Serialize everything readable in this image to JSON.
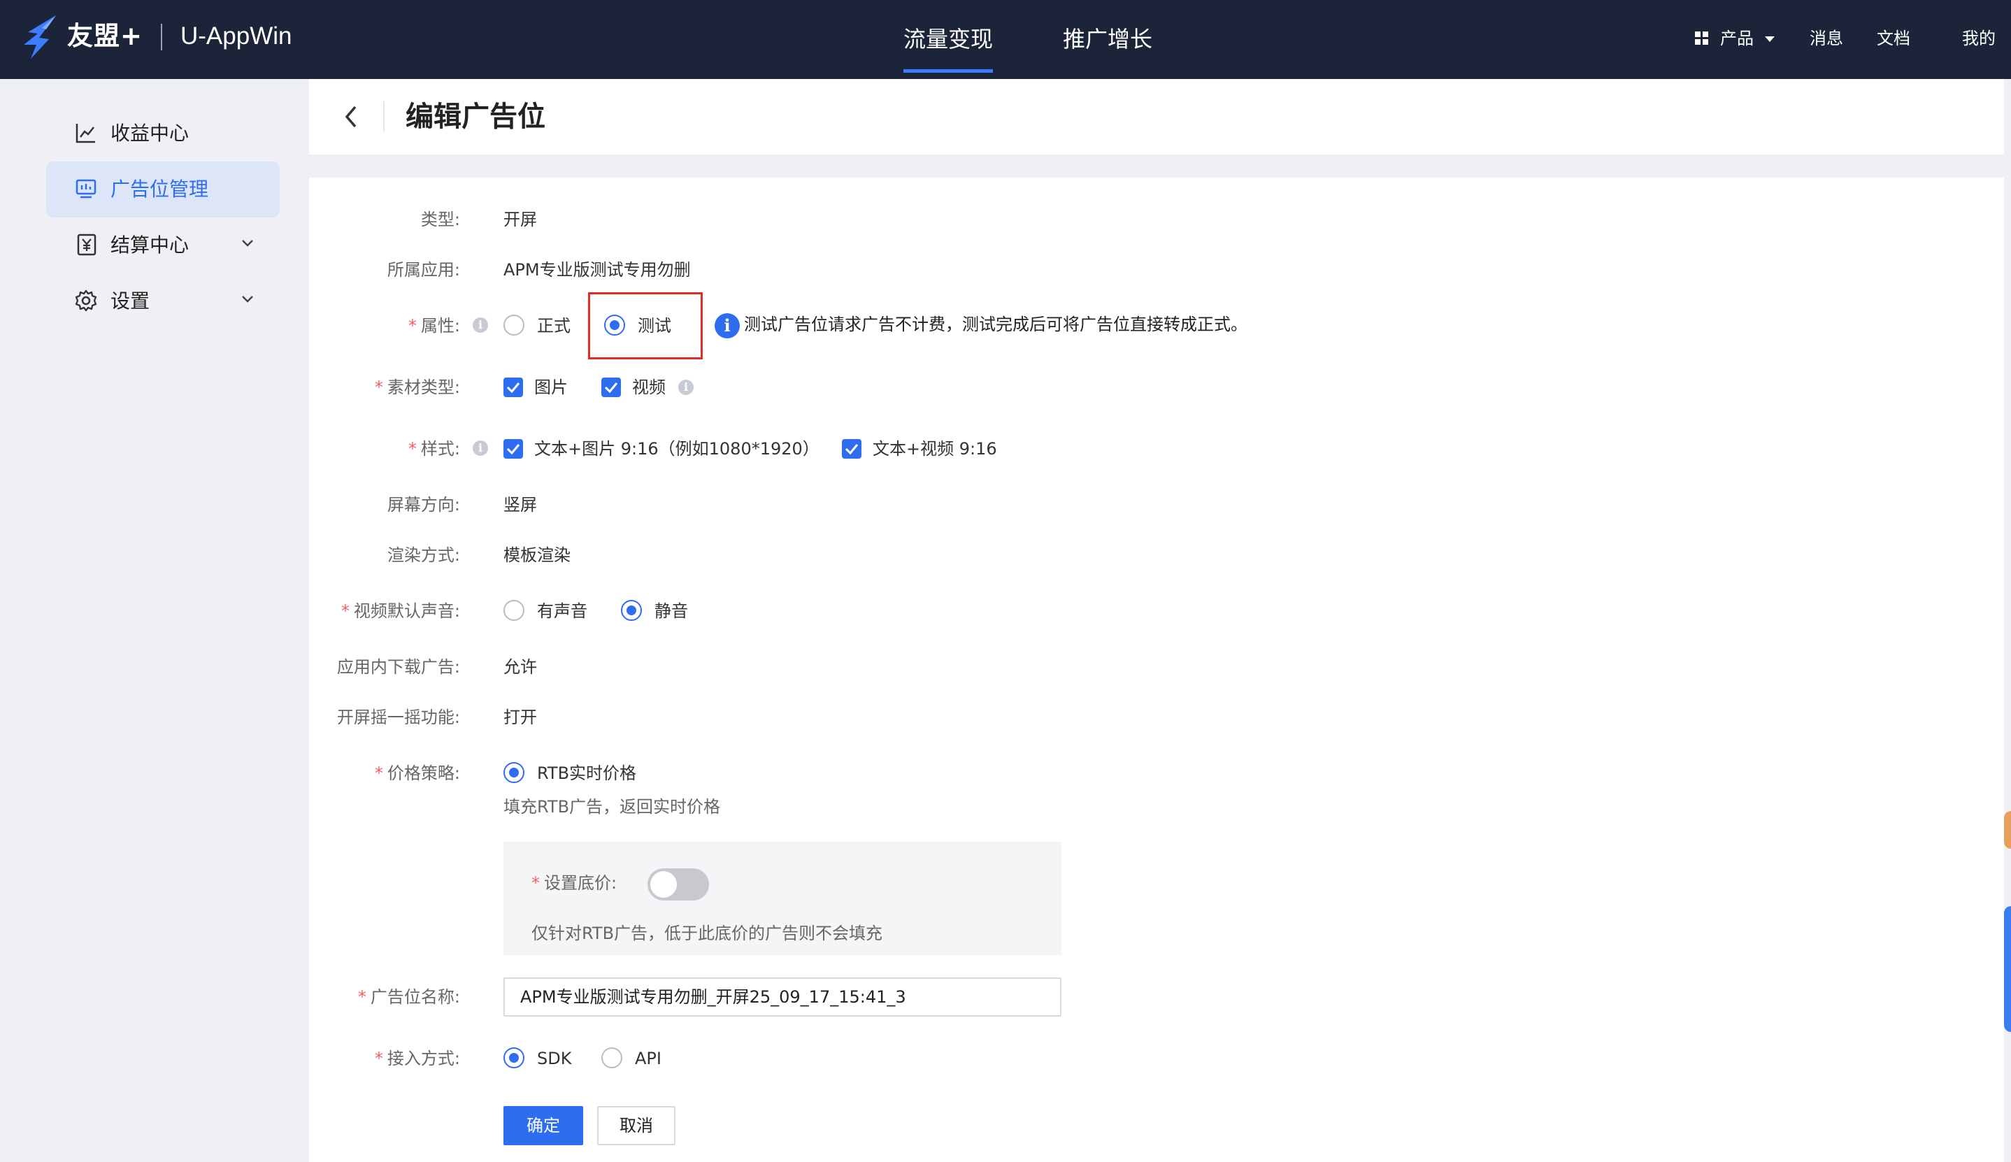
{
  "topbar": {
    "brand": "友盟+",
    "product": "U-AppWin",
    "nav": [
      "流量变现",
      "推广增长"
    ],
    "right": {
      "products": "产品",
      "messages": "消息",
      "docs": "文档",
      "mine": "我的"
    }
  },
  "sidebar": {
    "items": [
      {
        "label": "收益中心",
        "icon": "chart-icon"
      },
      {
        "label": "广告位管理",
        "icon": "monitor-icon",
        "active": true
      },
      {
        "label": "结算中心",
        "icon": "yen-icon"
      },
      {
        "label": "设置",
        "icon": "gear-icon"
      }
    ]
  },
  "header": {
    "title": "编辑广告位"
  },
  "form": {
    "type": {
      "label": "类型:",
      "value": "开屏"
    },
    "app": {
      "label": "所属应用:",
      "value": "APM专业版测试专用勿删"
    },
    "attribute": {
      "label": "属性:",
      "options": [
        "正式",
        "测试"
      ],
      "selected": "测试",
      "hint": "测试广告位请求广告不计费，测试完成后可将广告位直接转成正式。"
    },
    "material": {
      "label": "素材类型:",
      "options": [
        "图片",
        "视频"
      ]
    },
    "style": {
      "label": "样式:",
      "options": [
        "文本+图片 9:16（例如1080*1920）",
        "文本+视频 9:16"
      ]
    },
    "orientation": {
      "label": "屏幕方向:",
      "value": "竖屏"
    },
    "render": {
      "label": "渲染方式:",
      "value": "模板渲染"
    },
    "sound": {
      "label": "视频默认声音:",
      "options": [
        "有声音",
        "静音"
      ],
      "selected": "静音"
    },
    "download": {
      "label": "应用内下载广告:",
      "value": "允许"
    },
    "shake": {
      "label": "开屏摇一摇功能:",
      "value": "打开"
    },
    "price": {
      "label": "价格策略:",
      "option": "RTB实时价格",
      "desc": "填充RTB广告，返回实时价格",
      "floor_label": "设置底价:",
      "floor_enabled": false,
      "floor_desc": "仅针对RTB广告，低于此底价的广告则不会填充"
    },
    "name": {
      "label": "广告位名称:",
      "value": "APM专业版测试专用勿删_开屏25_09_17_15:41_3"
    },
    "access": {
      "label": "接入方式:",
      "options": [
        "SDK",
        "API"
      ],
      "selected": "SDK"
    },
    "buttons": {
      "confirm": "确定",
      "cancel": "取消"
    }
  },
  "colors": {
    "primary": "#2f6df0",
    "topbar": "#1c2439",
    "highlight_box": "#e02d24",
    "required": "#f0625e"
  }
}
